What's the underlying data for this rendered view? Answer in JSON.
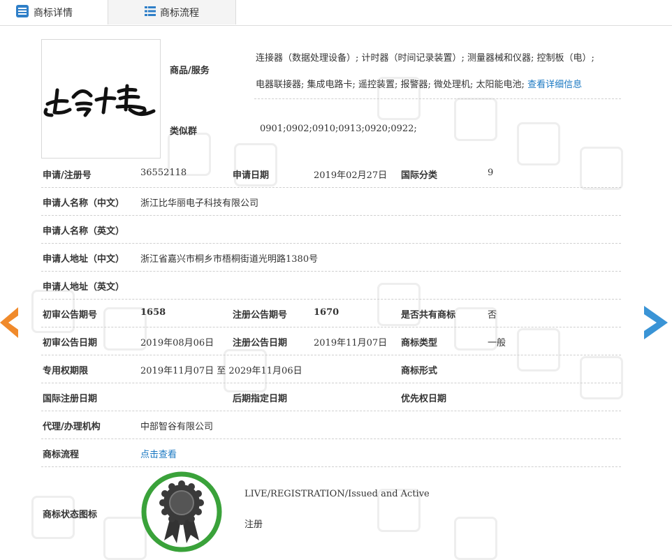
{
  "tabs": [
    {
      "label": "商标详情"
    },
    {
      "label": "商标流程"
    }
  ],
  "goods": {
    "label": "商品/服务",
    "line1": "连接器（数据处理设备）; 计时器（时间记录装置）; 测量器械和仪器; 控制板（电）;",
    "line2": "电器联接器; 集成电路卡; 遥控装置; 报警器; 微处理机; 太阳能电池;",
    "more_link": "查看详细信息"
  },
  "similar_group": {
    "label": "类似群",
    "value": "0901;0902;0910;0913;0920;0922;"
  },
  "fields": {
    "reg_no": {
      "label": "申请/注册号",
      "value": "36552118"
    },
    "apply_date": {
      "label": "申请日期",
      "value": "2019年02月27日"
    },
    "intl_class": {
      "label": "国际分类",
      "value": "9"
    },
    "applicant_cn": {
      "label": "申请人名称（中文）",
      "value": "浙江比华丽电子科技有限公司"
    },
    "applicant_en": {
      "label": "申请人名称（英文）",
      "value": ""
    },
    "address_cn": {
      "label": "申请人地址（中文）",
      "value": "浙江省嘉兴市桐乡市梧桐街道光明路1380号"
    },
    "address_en": {
      "label": "申请人地址（英文）",
      "value": ""
    },
    "prelim_no": {
      "label": "初审公告期号",
      "value": "1658"
    },
    "reg_pub_no": {
      "label": "注册公告期号",
      "value": "1670"
    },
    "shared": {
      "label": "是否共有商标",
      "value": "否"
    },
    "prelim_date": {
      "label": "初审公告日期",
      "value": "2019年08月06日"
    },
    "reg_pub_date": {
      "label": "注册公告日期",
      "value": "2019年11月07日"
    },
    "mark_type": {
      "label": "商标类型",
      "value": "一般"
    },
    "exclusive_period": {
      "label": "专用权期限",
      "value": "2019年11月07日 至 2029年11月06日"
    },
    "mark_form": {
      "label": "商标形式",
      "value": ""
    },
    "intl_reg_date": {
      "label": "国际注册日期",
      "value": ""
    },
    "later_date": {
      "label": "后期指定日期",
      "value": ""
    },
    "priority_date": {
      "label": "优先权日期",
      "value": ""
    },
    "agent": {
      "label": "代理/办理机构",
      "value": "中部智谷有限公司"
    },
    "flow": {
      "label": "商标流程",
      "value": "点击查看"
    },
    "status_icon": {
      "label": "商标状态图标"
    }
  },
  "status": {
    "text": "LIVE/REGISTRATION/Issued and Active",
    "cn": "注册"
  },
  "colors": {
    "link": "#1a78c2",
    "prev_arrow": "#f08a2b",
    "next_arrow": "#3a94d6",
    "status_ring": "#3aa23a",
    "tab_icon": "#2f7fc8"
  },
  "icons": {
    "tab1": "document-list-icon",
    "tab2": "list-icon",
    "status": "award-ribbon-icon",
    "prev": "chevron-left-icon",
    "next": "chevron-right-icon"
  }
}
